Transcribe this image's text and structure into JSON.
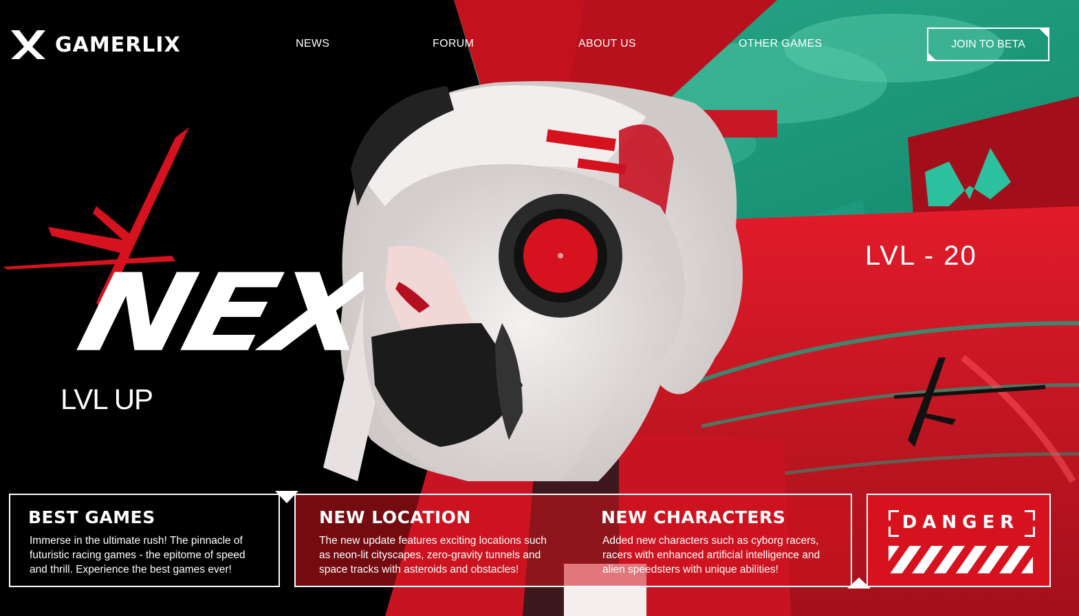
{
  "brand": {
    "name": "GAMERLIX",
    "logo_icon": "x-logo-icon",
    "accent_red": "#d6121f",
    "accent_teal": "#1fa486"
  },
  "nav": {
    "items": [
      {
        "label": "NEWS"
      },
      {
        "label": "FORUM"
      },
      {
        "label": "ABOUT US"
      },
      {
        "label": "OTHER GAMES"
      }
    ],
    "cta_label": "JOIN TO BETA"
  },
  "hero": {
    "title": "NEXUS",
    "tag_left": "LVL UP",
    "tag_right": "LVL - 20"
  },
  "cards": [
    {
      "title": "BEST GAMES",
      "lines": [
        "Immerse in the ultimate rush! The pinnacle of",
        "futuristic racing games - the epitome of speed",
        "and thrill. Experience the best games ever!"
      ]
    },
    {
      "title": "NEW LOCATION",
      "lines": [
        "The new update features exciting locations such",
        "as neon-lit cityscapes, zero-gravity tunnels and",
        "space tracks with asteroids and obstacles!"
      ]
    },
    {
      "title": "NEW CHARACTERS",
      "lines": [
        "Added new characters such as cyborg racers,",
        "racers with enhanced artificial intelligence and",
        "alien speedsters with unique abilities!"
      ]
    }
  ],
  "danger": {
    "label": "DANGER"
  }
}
